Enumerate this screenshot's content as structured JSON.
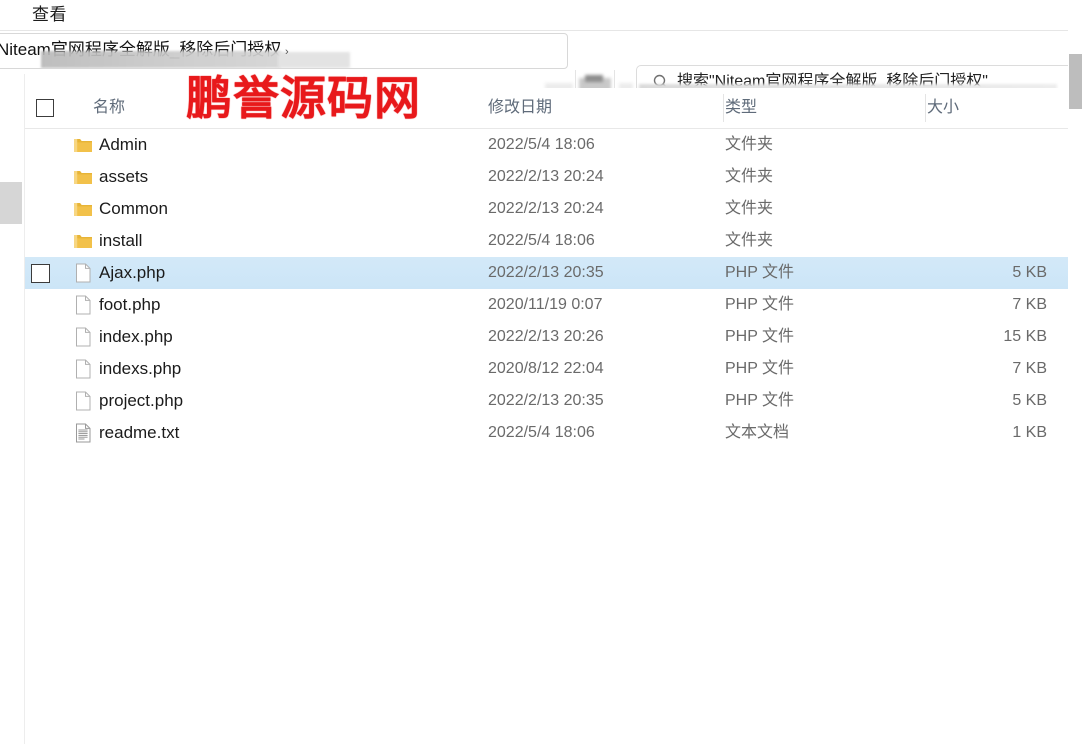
{
  "window": {
    "menu_label": "查看"
  },
  "address_bar": {
    "value": "Niteam官网程序全解版_移除后门授权",
    "separator": "›"
  },
  "search": {
    "value": "搜索\"Niteam官网程序全解版_移除后门授权\"",
    "icon": "search-icon"
  },
  "watermark": {
    "text": "鹏誉源码网",
    "color": "#e8191b"
  },
  "columns": {
    "name": "名称",
    "date": "修改日期",
    "type": "类型",
    "size": "大小"
  },
  "rows": [
    {
      "name": "Admin",
      "date": "2022/5/4 18:06",
      "type": "文件夹",
      "size": "",
      "icon": "folder-icon",
      "selected": false
    },
    {
      "name": "assets",
      "date": "2022/2/13 20:24",
      "type": "文件夹",
      "size": "",
      "icon": "folder-icon",
      "selected": false
    },
    {
      "name": "Common",
      "date": "2022/2/13 20:24",
      "type": "文件夹",
      "size": "",
      "icon": "folder-icon",
      "selected": false
    },
    {
      "name": "install",
      "date": "2022/5/4 18:06",
      "type": "文件夹",
      "size": "",
      "icon": "folder-icon",
      "selected": false
    },
    {
      "name": "Ajax.php",
      "date": "2022/2/13 20:35",
      "type": "PHP 文件",
      "size": "5 KB",
      "icon": "file-icon",
      "selected": true
    },
    {
      "name": "foot.php",
      "date": "2020/11/19 0:07",
      "type": "PHP 文件",
      "size": "7 KB",
      "icon": "file-icon",
      "selected": false
    },
    {
      "name": "index.php",
      "date": "2022/2/13 20:26",
      "type": "PHP 文件",
      "size": "15 KB",
      "icon": "file-icon",
      "selected": false
    },
    {
      "name": "indexs.php",
      "date": "2020/8/12 22:04",
      "type": "PHP 文件",
      "size": "7 KB",
      "icon": "file-icon",
      "selected": false
    },
    {
      "name": "project.php",
      "date": "2022/2/13 20:35",
      "type": "PHP 文件",
      "size": "5 KB",
      "icon": "file-icon",
      "selected": false
    },
    {
      "name": "readme.txt",
      "date": "2022/5/4 18:06",
      "type": "文本文档",
      "size": "1 KB",
      "icon": "text-file-icon",
      "selected": false
    }
  ]
}
